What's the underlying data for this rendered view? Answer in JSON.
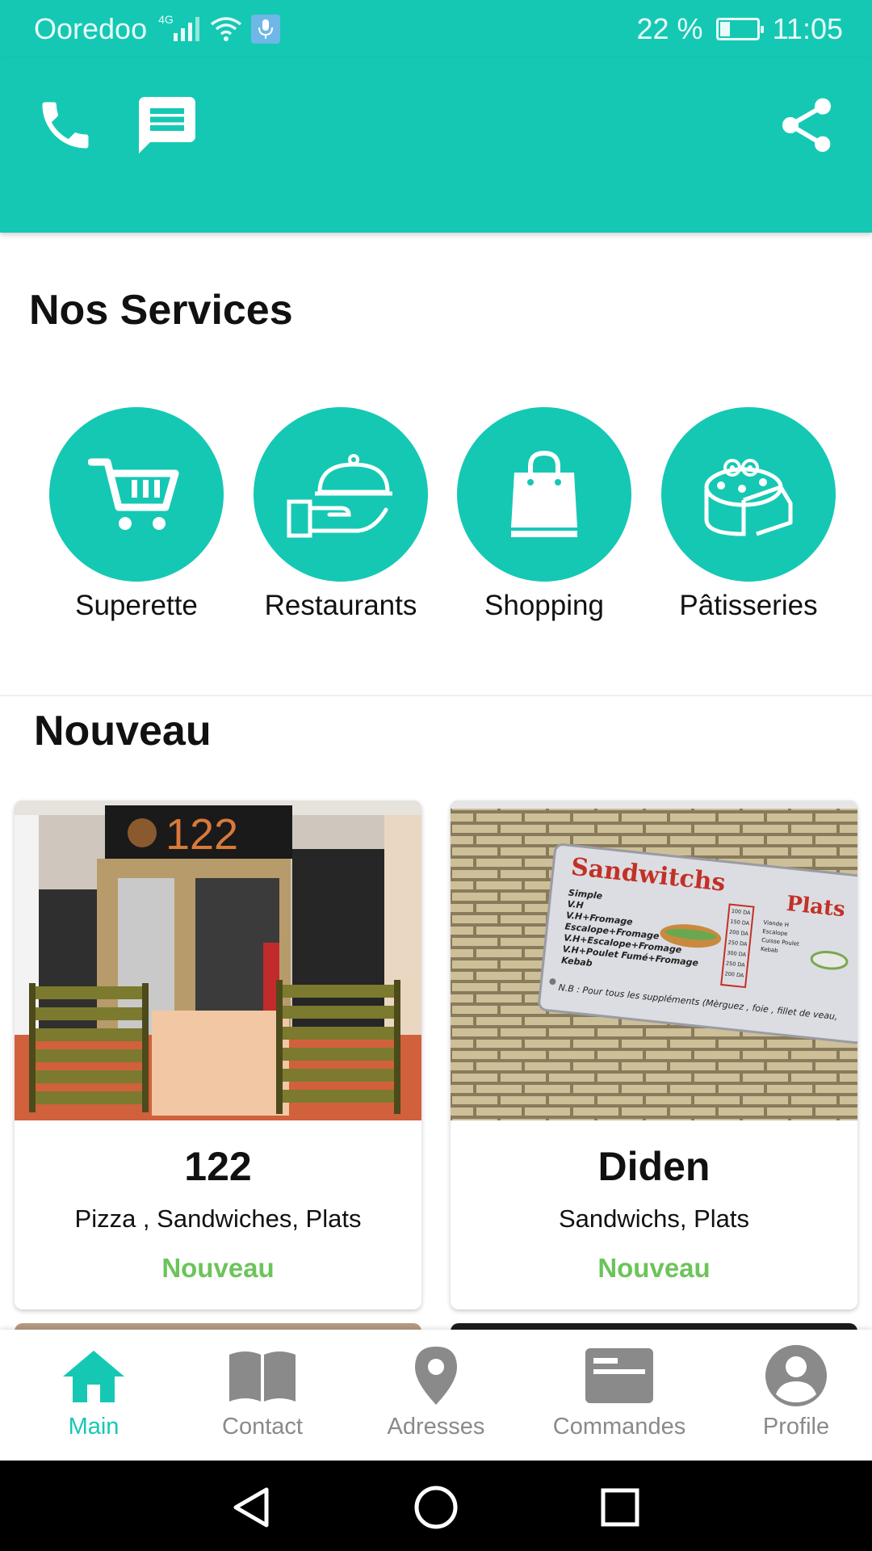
{
  "status_bar": {
    "carrier": "Ooredoo",
    "network": "4G",
    "battery": "22 %",
    "battery_level": 0.22,
    "time": "11:05"
  },
  "app_bar": {
    "icons": [
      "phone-icon",
      "message-icon",
      "share-icon"
    ]
  },
  "colors": {
    "primary": "#15c8b4",
    "new_badge": "#6cc45a",
    "nav_inactive": "#8a8a8a"
  },
  "services": {
    "title": "Nos Services",
    "items": [
      {
        "label": "Superette",
        "icon": "cart-icon"
      },
      {
        "label": "Restaurants",
        "icon": "serving-cloche-icon"
      },
      {
        "label": "Shopping",
        "icon": "shopping-bag-icon"
      },
      {
        "label": "Pâtisseries",
        "icon": "cake-icon"
      }
    ]
  },
  "new_section": {
    "title": "Nouveau",
    "cards": [
      {
        "name": "122",
        "tags": "Pizza , Sandwiches, Plats",
        "badge": "Nouveau",
        "photo_sign": "122"
      },
      {
        "name": "Diden",
        "tags": "Sandwichs, Plats",
        "badge": "Nouveau",
        "menu_board": {
          "left_title": "Sandwitchs",
          "right_title": "Plats",
          "items": [
            "Simple",
            "V.H",
            "V.H+Fromage",
            "Escalope+Fromage",
            "V.H+Escalope+Fromage",
            "V.H+Poulet Fumé+Fromage",
            "Kebab"
          ],
          "prices": [
            "100 DA",
            "150 DA",
            "200 DA",
            "250 DA",
            "300 DA",
            "250 DA",
            "200 DA"
          ],
          "plats": [
            "Viande H",
            "Escalope",
            "Cuisse Poulet",
            "Kebab"
          ],
          "note": "N.B : Pour tous les suppléments (Mèrguez , foie , fillet de veau,"
        }
      }
    ]
  },
  "bottom_nav": {
    "items": [
      {
        "label": "Main",
        "icon": "home-icon",
        "active": true
      },
      {
        "label": "Contact",
        "icon": "book-icon",
        "active": false
      },
      {
        "label": "Adresses",
        "icon": "location-pin-icon",
        "active": false
      },
      {
        "label": "Commandes",
        "icon": "orders-card-icon",
        "active": false
      },
      {
        "label": "Profile",
        "icon": "profile-icon",
        "active": false
      }
    ]
  },
  "system_nav": {
    "buttons": [
      "back-icon",
      "home-circle-icon",
      "recents-icon"
    ]
  }
}
